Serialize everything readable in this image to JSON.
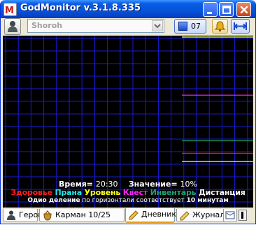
{
  "window": {
    "title": "GodMonitor v.3.1.8.335"
  },
  "toolbar": {
    "hero_select_value": "Shoroh",
    "count_value": "07"
  },
  "chart_info": {
    "time_label": "Время=",
    "time_value": "20:30",
    "value_label": "Значение=",
    "value_value": "10%",
    "division_prefix": "Одио деление",
    "division_text": " по горизонтали соответствует ",
    "division_value": "10 минутам"
  },
  "legend": {
    "health": "Здоровье",
    "prana": "Прана",
    "level": "Уровень",
    "quest": "Квест",
    "inventory": "Инвентарь",
    "distance": "Дистанция"
  },
  "colors": {
    "health": "#ff2020",
    "prana": "#20e8e8",
    "level": "#ffff20",
    "quest": "#ff20ff",
    "inventory": "#20a060",
    "distance": "#f8f8f8",
    "grid": "#1a1ad8"
  },
  "tabs": [
    {
      "label": "Герой",
      "icon": "hero-icon"
    },
    {
      "label": "Карман 10/25",
      "icon": "pocket-icon"
    },
    {
      "label": "Дневник",
      "icon": "diary-icon"
    },
    {
      "label": "Журнал",
      "icon": "journal-icon"
    }
  ],
  "chart_data": {
    "type": "line",
    "title": "",
    "xlabel": "",
    "ylabel": "",
    "ylim": [
      0,
      100
    ],
    "grid": true,
    "legend_position": "bottom",
    "value_unit": "%",
    "x": [
      0,
      1,
      2,
      3,
      4,
      5,
      6,
      7,
      8,
      9,
      10,
      11,
      12,
      13,
      14,
      15,
      16,
      17,
      18,
      19,
      20,
      21,
      22,
      23,
      24,
      25,
      26,
      27,
      28,
      29,
      30,
      31,
      32,
      33,
      34,
      35,
      36,
      37,
      38,
      39,
      40,
      41,
      42,
      43,
      44,
      45,
      46,
      47,
      48,
      49,
      50,
      51,
      52,
      53,
      54,
      55,
      56,
      57,
      58,
      59,
      60,
      61,
      62,
      63,
      64,
      65,
      66,
      67,
      68,
      69,
      70,
      71,
      72,
      73,
      74,
      75,
      76,
      77,
      78,
      79,
      80,
      81,
      82,
      83,
      84,
      85,
      86,
      87,
      88,
      89,
      90,
      91,
      92,
      93,
      94,
      95,
      96,
      97,
      98,
      99,
      100
    ],
    "series": [
      {
        "name": "Здоровье",
        "values": [
          16,
          16,
          16,
          16,
          16,
          16,
          16,
          16,
          16,
          16,
          16,
          16,
          16,
          16,
          16,
          16,
          16,
          16,
          16,
          16,
          16,
          16,
          16,
          16,
          16,
          16,
          16,
          16,
          16,
          16,
          16,
          16,
          16,
          16,
          16,
          16,
          16,
          16,
          16,
          16,
          16,
          16,
          16,
          16,
          16,
          16,
          16,
          16,
          16,
          16,
          16,
          16,
          16,
          16,
          16,
          16,
          16,
          16,
          16,
          16,
          16,
          16,
          16,
          16,
          16,
          16,
          16,
          16,
          16,
          16,
          16,
          16,
          16,
          16,
          16,
          16,
          16,
          16,
          16,
          16,
          16,
          16,
          16,
          16,
          16,
          16,
          16,
          16,
          16,
          16,
          16,
          16,
          16,
          16,
          16,
          16,
          16,
          16,
          16,
          16,
          16
        ]
      },
      {
        "name": "Прана",
        "values": [
          100,
          100,
          100,
          100,
          100,
          100,
          100,
          100,
          100,
          100,
          100,
          100,
          100,
          100,
          100,
          100,
          100,
          100,
          100,
          100,
          100,
          100,
          100,
          100,
          100,
          100,
          100,
          100,
          100,
          100,
          100,
          100,
          100,
          100,
          100,
          100,
          100,
          100,
          100,
          100,
          100,
          100,
          100,
          100,
          100,
          100,
          100,
          100,
          100,
          100,
          100,
          100,
          100,
          100,
          100,
          100,
          100,
          100,
          100,
          100,
          100,
          100,
          100,
          100,
          100,
          100,
          100,
          100,
          100,
          100,
          100,
          100,
          100,
          100,
          100,
          100,
          100,
          100,
          100,
          100,
          100,
          100,
          100,
          100,
          100,
          100,
          100,
          100,
          100,
          100,
          100,
          100,
          100,
          100,
          100,
          100,
          100,
          100,
          100,
          100,
          100
        ]
      },
      {
        "name": "Уровень",
        "values": [
          100,
          100,
          100,
          100,
          100,
          100,
          100,
          100,
          100,
          100,
          100,
          100,
          100,
          100,
          100,
          100,
          100,
          100,
          100,
          100,
          100,
          100,
          100,
          100,
          100,
          100,
          100,
          100,
          100,
          100,
          100,
          100,
          100,
          100,
          100,
          100,
          100,
          100,
          100,
          100,
          100,
          100,
          100,
          100,
          100,
          100,
          100,
          100,
          100,
          100,
          100,
          100,
          100,
          100,
          100,
          100,
          100,
          100,
          100,
          100,
          100,
          100,
          100,
          100,
          100,
          100,
          100,
          100,
          100,
          100,
          100,
          100,
          100,
          100,
          100,
          100,
          100,
          100,
          100,
          100,
          100,
          100,
          100,
          100,
          100,
          100,
          100,
          100,
          100,
          100,
          100,
          100,
          100,
          100,
          100,
          100,
          100,
          100,
          100,
          100,
          100
        ]
      },
      {
        "name": "Квест",
        "values": [
          58,
          58,
          58,
          58,
          58,
          58,
          58,
          58,
          58,
          58,
          58,
          58,
          58,
          58,
          58,
          58,
          58,
          58,
          58,
          58,
          58,
          58,
          58,
          58,
          58,
          58,
          58,
          58,
          58,
          58,
          58,
          58,
          58,
          58,
          58,
          58,
          58,
          58,
          58,
          58,
          58,
          58,
          58,
          58,
          58,
          58,
          58,
          58,
          58,
          58,
          58,
          58,
          58,
          58,
          58,
          58,
          58,
          58,
          58,
          58,
          58,
          58,
          58,
          58,
          58,
          58,
          58,
          58,
          58,
          58,
          58,
          58,
          58,
          58,
          58,
          58,
          58,
          58,
          58,
          58,
          58,
          58,
          58,
          58,
          58,
          58,
          58,
          58,
          58,
          58,
          58,
          58,
          58,
          58,
          58,
          58,
          58,
          58,
          58,
          58,
          58
        ]
      },
      {
        "name": "Инвентарь",
        "values": [
          25,
          25,
          25,
          25,
          25,
          25,
          25,
          25,
          25,
          25,
          25,
          25,
          25,
          25,
          25,
          25,
          25,
          25,
          25,
          25,
          25,
          25,
          25,
          25,
          25,
          25,
          25,
          25,
          25,
          25,
          25,
          25,
          25,
          25,
          25,
          25,
          25,
          25,
          25,
          25,
          25,
          25,
          25,
          25,
          25,
          25,
          25,
          25,
          25,
          25,
          25,
          25,
          25,
          25,
          25,
          25,
          25,
          25,
          25,
          25,
          25,
          25,
          25,
          25,
          25,
          25,
          25,
          25,
          25,
          25,
          25,
          25,
          25,
          25,
          25,
          25,
          25,
          25,
          25,
          25,
          25,
          25,
          25,
          25,
          25,
          25,
          25,
          25,
          25,
          25,
          25,
          25,
          25,
          25,
          25,
          25,
          25,
          25,
          25,
          25,
          25
        ]
      },
      {
        "name": "Дистанция",
        "values": [
          10,
          10,
          10,
          10,
          10,
          10,
          10,
          10,
          10,
          10,
          10,
          10,
          10,
          10,
          10,
          10,
          10,
          10,
          10,
          10,
          10,
          10,
          10,
          10,
          10,
          10,
          10,
          10,
          10,
          10,
          10,
          10,
          10,
          10,
          10,
          10,
          10,
          10,
          10,
          10,
          10,
          10,
          10,
          10,
          10,
          10,
          10,
          10,
          10,
          10,
          10,
          10,
          10,
          10,
          10,
          10,
          10,
          10,
          10,
          10,
          10,
          10,
          10,
          10,
          10,
          10,
          10,
          10,
          10,
          10,
          10,
          10,
          10,
          10,
          10,
          10,
          10,
          10,
          10,
          10,
          10,
          10,
          10,
          10,
          10,
          10,
          10,
          10,
          10,
          10,
          10,
          10,
          10,
          10,
          10,
          10,
          10,
          10,
          10,
          10,
          10
        ]
      }
    ]
  }
}
